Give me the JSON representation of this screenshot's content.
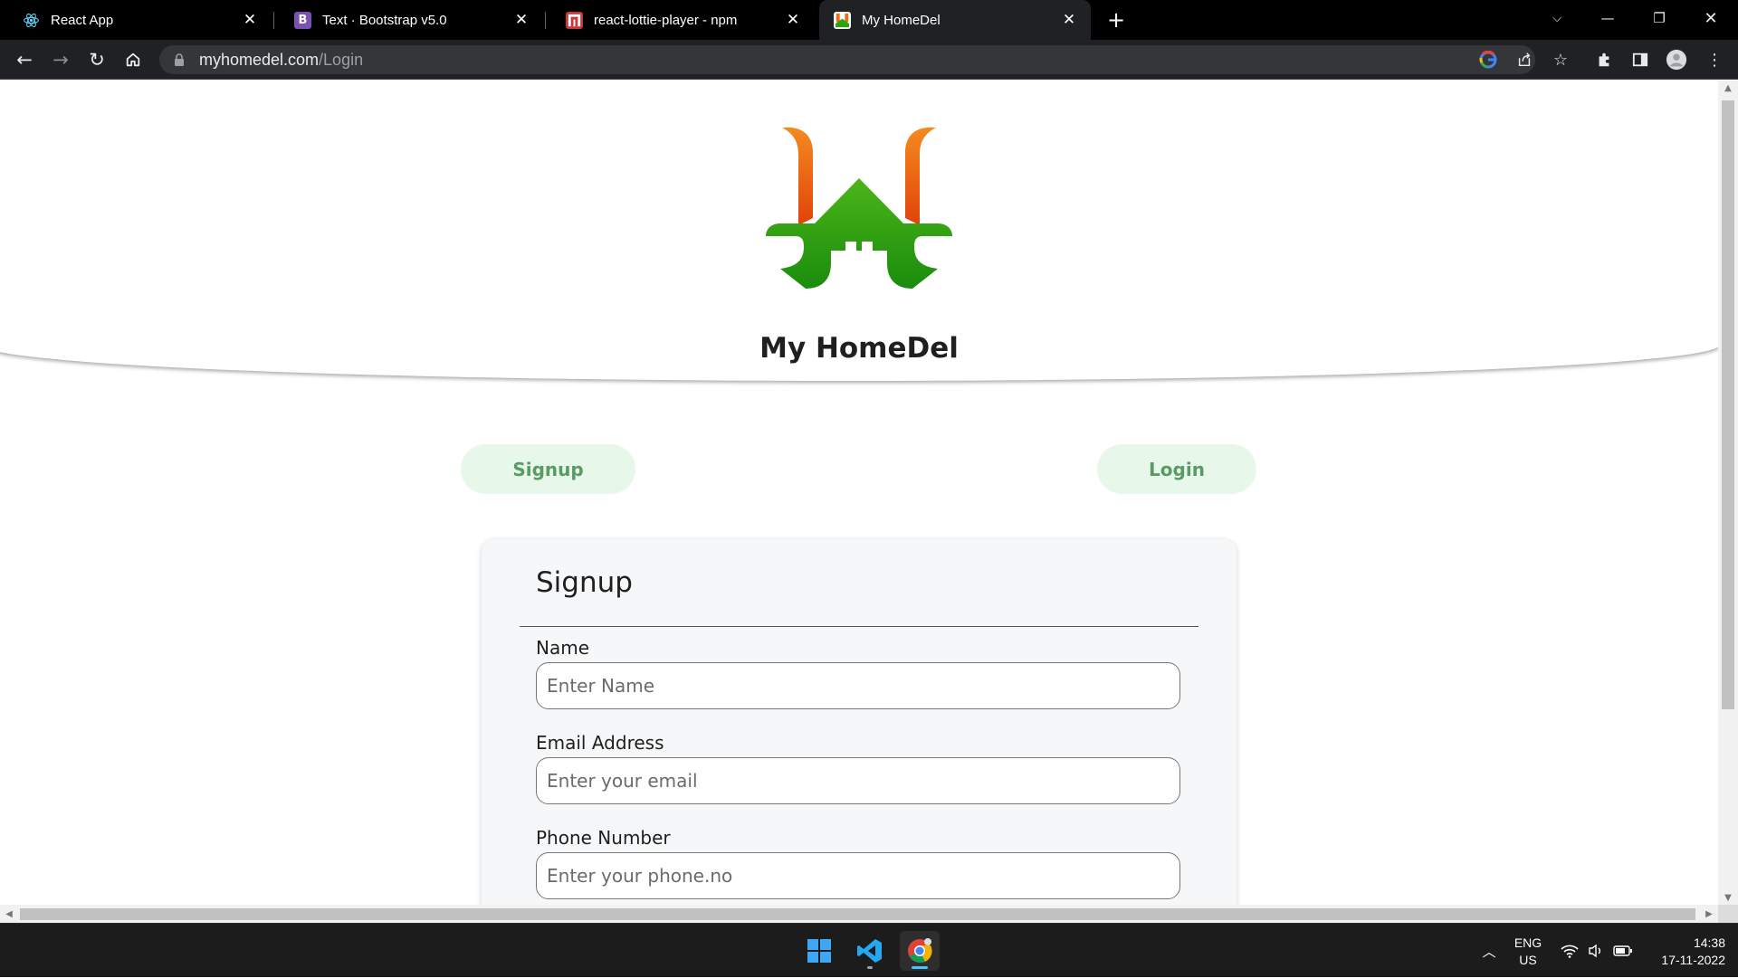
{
  "browser": {
    "tabs": [
      {
        "title": "React App",
        "icon": "react-icon",
        "active": false
      },
      {
        "title": "Text · Bootstrap v5.0",
        "icon": "bootstrap-icon",
        "active": false
      },
      {
        "title": "react-lottie-player - npm",
        "icon": "npm-icon",
        "active": false
      },
      {
        "title": "My HomeDel",
        "icon": "homedel-icon",
        "active": true
      }
    ],
    "address": {
      "host": "myhomedel.com",
      "path": "/Login"
    }
  },
  "page": {
    "brand_name": "My HomeDel",
    "nav": {
      "signup_label": "Signup",
      "login_label": "Login"
    },
    "form": {
      "title": "Signup",
      "fields": [
        {
          "label": "Name",
          "placeholder": "Enter Name"
        },
        {
          "label": "Email Address",
          "placeholder": "Enter your email"
        },
        {
          "label": "Phone Number",
          "placeholder": "Enter your phone.no"
        }
      ]
    }
  },
  "taskbar": {
    "language": {
      "line1": "ENG",
      "line2": "US"
    },
    "time": "14:38",
    "date": "17-11-2022"
  },
  "colors": {
    "logo_orange": "#f26b0f",
    "logo_green": "#2aa40f",
    "pill_bg": "#e7f8ea",
    "pill_text": "#5a9b63"
  }
}
